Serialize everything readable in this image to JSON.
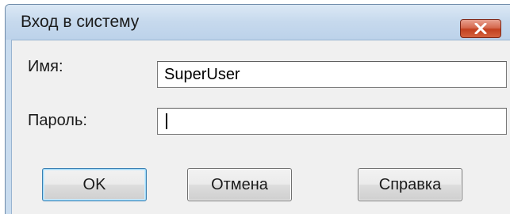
{
  "window": {
    "title": "Вход в систему"
  },
  "icons": {
    "close": "close-icon"
  },
  "form": {
    "username_label": "Имя:",
    "username_value": "SuperUser",
    "password_label": "Пароль:",
    "password_value": ""
  },
  "buttons": {
    "ok": "OK",
    "cancel": "Отмена",
    "help": "Справка"
  },
  "colors": {
    "close_button": "#c2401f",
    "titlebar": "#c9dcef",
    "client_background": "#f0f0f0"
  }
}
